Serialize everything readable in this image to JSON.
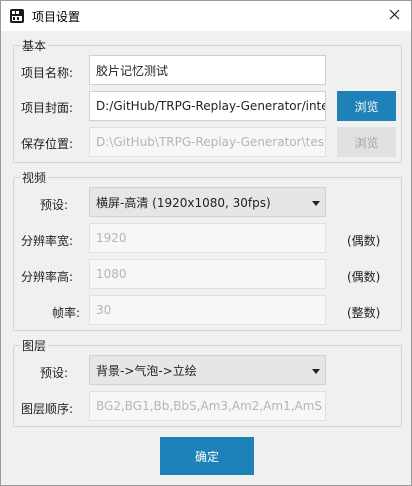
{
  "window": {
    "title": "项目设置",
    "close_icon": "close-icon"
  },
  "basic": {
    "legend": "基本",
    "name_label": "项目名称:",
    "name_value": "胶片记忆测试",
    "cover_label": "项目封面:",
    "cover_value": "D:/GitHub/TRPG-Replay-Generator/inte",
    "cover_browse": "浏览",
    "save_label": "保存位置:",
    "save_value": "D:\\GitHub\\TRPG-Replay-Generator\\tes",
    "save_browse": "浏览"
  },
  "video": {
    "legend": "视频",
    "preset_label": "预设:",
    "preset_value": "横屏-高清 (1920x1080, 30fps)",
    "width_label": "分辨率宽:",
    "width_value": "1920",
    "width_suffix": "(偶数)",
    "height_label": "分辨率高:",
    "height_value": "1080",
    "height_suffix": "(偶数)",
    "fps_label": "帧率:",
    "fps_value": "30",
    "fps_suffix": "(整数)"
  },
  "layer": {
    "legend": "图层",
    "preset_label": "预设:",
    "preset_value": "背景->气泡->立绘",
    "order_label": "图层顺序:",
    "order_value": "BG2,BG1,Bb,BbS,Am3,Am2,Am1,AmS"
  },
  "confirm_label": "确定",
  "colors": {
    "accent": "#1e81b8"
  }
}
